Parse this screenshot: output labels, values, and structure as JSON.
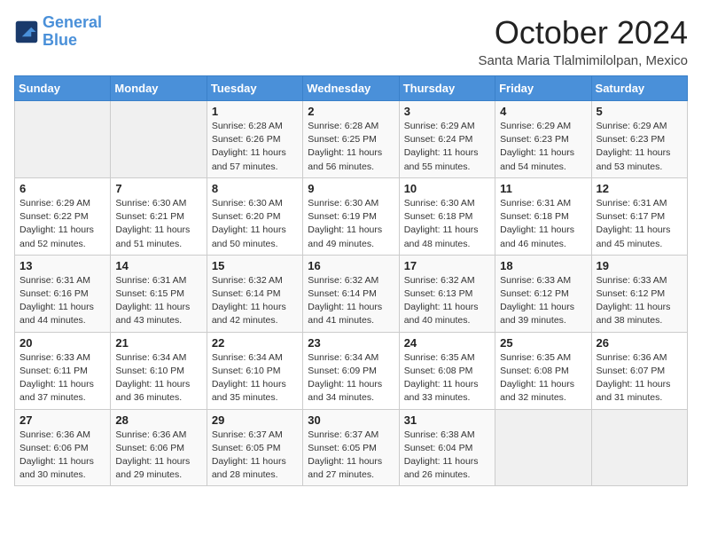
{
  "logo": {
    "line1": "General",
    "line2": "Blue"
  },
  "title": "October 2024",
  "location": "Santa Maria Tlalmimilolpan, Mexico",
  "days_of_week": [
    "Sunday",
    "Monday",
    "Tuesday",
    "Wednesday",
    "Thursday",
    "Friday",
    "Saturday"
  ],
  "weeks": [
    [
      {
        "num": "",
        "info": ""
      },
      {
        "num": "",
        "info": ""
      },
      {
        "num": "1",
        "info": "Sunrise: 6:28 AM\nSunset: 6:26 PM\nDaylight: 11 hours and 57 minutes."
      },
      {
        "num": "2",
        "info": "Sunrise: 6:28 AM\nSunset: 6:25 PM\nDaylight: 11 hours and 56 minutes."
      },
      {
        "num": "3",
        "info": "Sunrise: 6:29 AM\nSunset: 6:24 PM\nDaylight: 11 hours and 55 minutes."
      },
      {
        "num": "4",
        "info": "Sunrise: 6:29 AM\nSunset: 6:23 PM\nDaylight: 11 hours and 54 minutes."
      },
      {
        "num": "5",
        "info": "Sunrise: 6:29 AM\nSunset: 6:23 PM\nDaylight: 11 hours and 53 minutes."
      }
    ],
    [
      {
        "num": "6",
        "info": "Sunrise: 6:29 AM\nSunset: 6:22 PM\nDaylight: 11 hours and 52 minutes."
      },
      {
        "num": "7",
        "info": "Sunrise: 6:30 AM\nSunset: 6:21 PM\nDaylight: 11 hours and 51 minutes."
      },
      {
        "num": "8",
        "info": "Sunrise: 6:30 AM\nSunset: 6:20 PM\nDaylight: 11 hours and 50 minutes."
      },
      {
        "num": "9",
        "info": "Sunrise: 6:30 AM\nSunset: 6:19 PM\nDaylight: 11 hours and 49 minutes."
      },
      {
        "num": "10",
        "info": "Sunrise: 6:30 AM\nSunset: 6:18 PM\nDaylight: 11 hours and 48 minutes."
      },
      {
        "num": "11",
        "info": "Sunrise: 6:31 AM\nSunset: 6:18 PM\nDaylight: 11 hours and 46 minutes."
      },
      {
        "num": "12",
        "info": "Sunrise: 6:31 AM\nSunset: 6:17 PM\nDaylight: 11 hours and 45 minutes."
      }
    ],
    [
      {
        "num": "13",
        "info": "Sunrise: 6:31 AM\nSunset: 6:16 PM\nDaylight: 11 hours and 44 minutes."
      },
      {
        "num": "14",
        "info": "Sunrise: 6:31 AM\nSunset: 6:15 PM\nDaylight: 11 hours and 43 minutes."
      },
      {
        "num": "15",
        "info": "Sunrise: 6:32 AM\nSunset: 6:14 PM\nDaylight: 11 hours and 42 minutes."
      },
      {
        "num": "16",
        "info": "Sunrise: 6:32 AM\nSunset: 6:14 PM\nDaylight: 11 hours and 41 minutes."
      },
      {
        "num": "17",
        "info": "Sunrise: 6:32 AM\nSunset: 6:13 PM\nDaylight: 11 hours and 40 minutes."
      },
      {
        "num": "18",
        "info": "Sunrise: 6:33 AM\nSunset: 6:12 PM\nDaylight: 11 hours and 39 minutes."
      },
      {
        "num": "19",
        "info": "Sunrise: 6:33 AM\nSunset: 6:12 PM\nDaylight: 11 hours and 38 minutes."
      }
    ],
    [
      {
        "num": "20",
        "info": "Sunrise: 6:33 AM\nSunset: 6:11 PM\nDaylight: 11 hours and 37 minutes."
      },
      {
        "num": "21",
        "info": "Sunrise: 6:34 AM\nSunset: 6:10 PM\nDaylight: 11 hours and 36 minutes."
      },
      {
        "num": "22",
        "info": "Sunrise: 6:34 AM\nSunset: 6:10 PM\nDaylight: 11 hours and 35 minutes."
      },
      {
        "num": "23",
        "info": "Sunrise: 6:34 AM\nSunset: 6:09 PM\nDaylight: 11 hours and 34 minutes."
      },
      {
        "num": "24",
        "info": "Sunrise: 6:35 AM\nSunset: 6:08 PM\nDaylight: 11 hours and 33 minutes."
      },
      {
        "num": "25",
        "info": "Sunrise: 6:35 AM\nSunset: 6:08 PM\nDaylight: 11 hours and 32 minutes."
      },
      {
        "num": "26",
        "info": "Sunrise: 6:36 AM\nSunset: 6:07 PM\nDaylight: 11 hours and 31 minutes."
      }
    ],
    [
      {
        "num": "27",
        "info": "Sunrise: 6:36 AM\nSunset: 6:06 PM\nDaylight: 11 hours and 30 minutes."
      },
      {
        "num": "28",
        "info": "Sunrise: 6:36 AM\nSunset: 6:06 PM\nDaylight: 11 hours and 29 minutes."
      },
      {
        "num": "29",
        "info": "Sunrise: 6:37 AM\nSunset: 6:05 PM\nDaylight: 11 hours and 28 minutes."
      },
      {
        "num": "30",
        "info": "Sunrise: 6:37 AM\nSunset: 6:05 PM\nDaylight: 11 hours and 27 minutes."
      },
      {
        "num": "31",
        "info": "Sunrise: 6:38 AM\nSunset: 6:04 PM\nDaylight: 11 hours and 26 minutes."
      },
      {
        "num": "",
        "info": ""
      },
      {
        "num": "",
        "info": ""
      }
    ]
  ]
}
